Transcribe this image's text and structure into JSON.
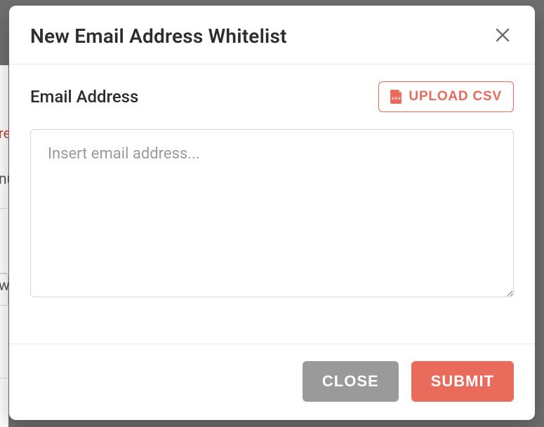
{
  "modal": {
    "title": "New Email Address Whitelist",
    "field_label": "Email Address",
    "upload_label": "UPLOAD CSV",
    "textarea_placeholder": "Insert email address...",
    "textarea_value": "",
    "close_button_label": "Close"
  },
  "footer": {
    "close_label": "CLOSE",
    "submit_label": "SUBMIT"
  },
  "colors": {
    "accent": "#e86b5c",
    "secondary": "#9a9a9a",
    "border": "#d6d6d6",
    "text": "#2d2d2d",
    "placeholder": "#9a9a9a"
  },
  "background_hints": {
    "text1": "re",
    "text2": "nu",
    "text3": "w"
  }
}
